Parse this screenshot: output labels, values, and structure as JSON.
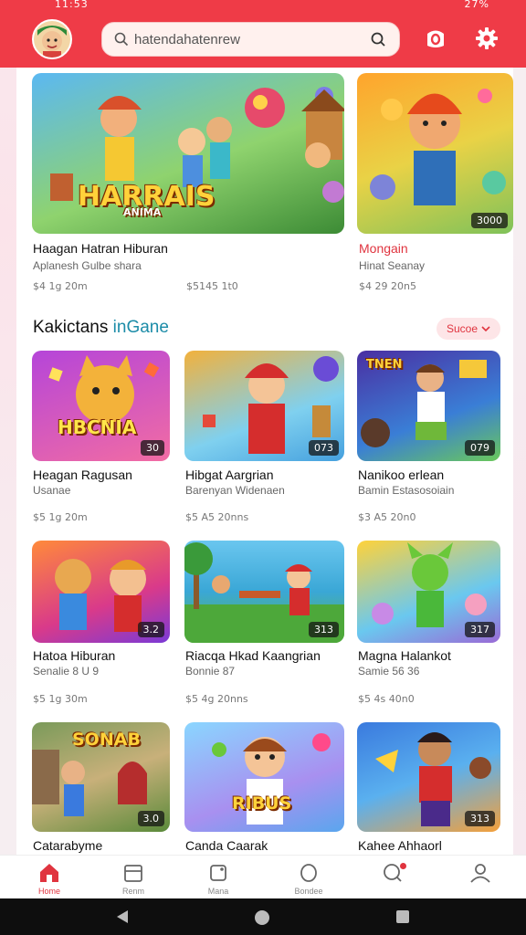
{
  "status": {
    "time": "11:53",
    "right": "27%"
  },
  "search": {
    "placeholder": "hatendahatenrew"
  },
  "featured": [
    {
      "title": "Haagan Hatran Hiburan",
      "subtitle": "Aplanesh Gulbe shara",
      "meta_left": "$4 1g 20m",
      "meta_right": "$5145 1t0",
      "logo": "HARRAIS",
      "logo_sub": "ANIMA"
    },
    {
      "title": "Mongain",
      "subtitle": "Hinat Seanay",
      "meta_left": "$4 29 20n5",
      "badge": "3000"
    }
  ],
  "section": {
    "title_a": "Kakictans",
    "title_b": " inGane",
    "see_more": "Sucoe"
  },
  "grid": [
    {
      "title": "Heagan Ragusan",
      "subtitle": "Usanae",
      "meta": "$5 1g 20m",
      "badge": "30",
      "logo": "HBCNIA"
    },
    {
      "title": "Hibgat Aargrian",
      "subtitle": "Barenyan Widenaen",
      "meta": "$5 A5 20nns",
      "badge": "073"
    },
    {
      "title": "Nanikoo erlean",
      "subtitle": "Bamin Estasosoiain",
      "meta": "$3 A5 20n0",
      "badge": "079",
      "logo": "TNEN"
    },
    {
      "title": "Hatoa Hiburan",
      "subtitle": "Senalie 8 U 9",
      "meta": "$5 1g 30m",
      "badge": "3.2"
    },
    {
      "title": "Riacqa Hkad Kaangrian",
      "subtitle": "Bonnie 87",
      "meta": "$5 4g 20nns",
      "badge": "313"
    },
    {
      "title": "Magna Halankot",
      "subtitle": "Samie 56 36",
      "meta": "$5 4s 40n0",
      "badge": "317"
    },
    {
      "title": "Catarabyme",
      "subtitle": "",
      "meta": "",
      "badge": "3.0",
      "logo": "SONAB"
    },
    {
      "title": "Canda Caarak",
      "subtitle": "",
      "meta": "",
      "badge": "",
      "logo": "RIBUS"
    },
    {
      "title": "Kahee Ahhaorl",
      "subtitle": "",
      "meta": "",
      "badge": "313"
    }
  ],
  "nav": [
    {
      "label": "Home",
      "icon": "home-icon"
    },
    {
      "label": "Renm",
      "icon": "store-icon"
    },
    {
      "label": "Mana",
      "icon": "tag-icon"
    },
    {
      "label": "Bondee",
      "icon": "circle-icon"
    },
    {
      "label": "",
      "icon": "chat-icon"
    },
    {
      "label": "",
      "icon": "profile-icon"
    }
  ]
}
